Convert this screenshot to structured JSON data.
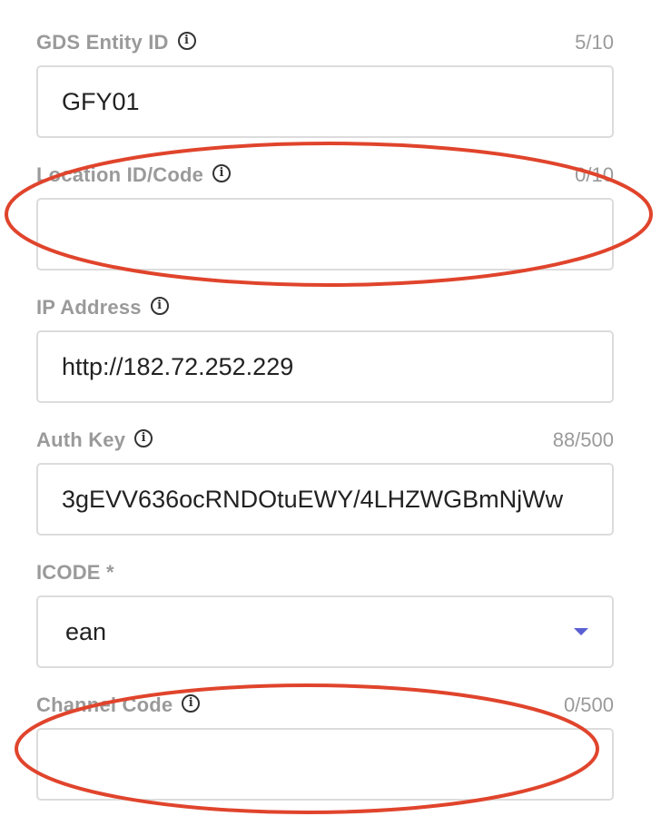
{
  "fields": {
    "gds_entity_id": {
      "label": "GDS Entity ID",
      "counter": "5/10",
      "value": "GFY01"
    },
    "location_id": {
      "label": "Location ID/Code",
      "counter": "0/10",
      "value": ""
    },
    "ip_address": {
      "label": "IP Address",
      "value": "http://182.72.252.229"
    },
    "auth_key": {
      "label": "Auth Key",
      "counter": "88/500",
      "value": "3gEVV636ocRNDOtuEWY/4LHZWGBmNjWw"
    },
    "icode": {
      "label": "ICODE *",
      "selected": "ean"
    },
    "channel_code": {
      "label": "Channel Code",
      "counter": "0/500",
      "value": ""
    }
  },
  "colors": {
    "annotation": "#e0442c",
    "caret": "#5a5fd4"
  },
  "icons": {
    "info": "info-icon",
    "dropdown": "caret-down-icon"
  }
}
